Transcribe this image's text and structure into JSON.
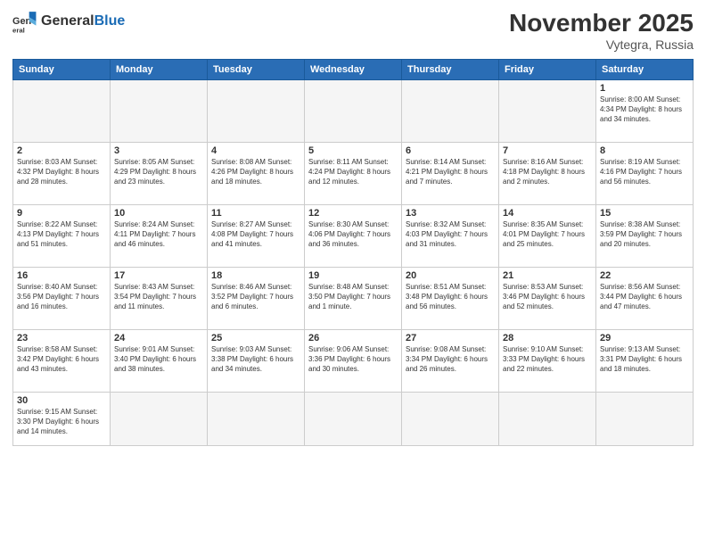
{
  "header": {
    "logo_general": "General",
    "logo_blue": "Blue",
    "title": "November 2025",
    "subtitle": "Vytegra, Russia"
  },
  "days_of_week": [
    "Sunday",
    "Monday",
    "Tuesday",
    "Wednesday",
    "Thursday",
    "Friday",
    "Saturday"
  ],
  "weeks": [
    [
      {
        "day": "",
        "info": "",
        "empty": true
      },
      {
        "day": "",
        "info": "",
        "empty": true
      },
      {
        "day": "",
        "info": "",
        "empty": true
      },
      {
        "day": "",
        "info": "",
        "empty": true
      },
      {
        "day": "",
        "info": "",
        "empty": true
      },
      {
        "day": "",
        "info": "",
        "empty": true
      },
      {
        "day": "1",
        "info": "Sunrise: 8:00 AM\nSunset: 4:34 PM\nDaylight: 8 hours\nand 34 minutes."
      }
    ],
    [
      {
        "day": "2",
        "info": "Sunrise: 8:03 AM\nSunset: 4:32 PM\nDaylight: 8 hours\nand 28 minutes."
      },
      {
        "day": "3",
        "info": "Sunrise: 8:05 AM\nSunset: 4:29 PM\nDaylight: 8 hours\nand 23 minutes."
      },
      {
        "day": "4",
        "info": "Sunrise: 8:08 AM\nSunset: 4:26 PM\nDaylight: 8 hours\nand 18 minutes."
      },
      {
        "day": "5",
        "info": "Sunrise: 8:11 AM\nSunset: 4:24 PM\nDaylight: 8 hours\nand 12 minutes."
      },
      {
        "day": "6",
        "info": "Sunrise: 8:14 AM\nSunset: 4:21 PM\nDaylight: 8 hours\nand 7 minutes."
      },
      {
        "day": "7",
        "info": "Sunrise: 8:16 AM\nSunset: 4:18 PM\nDaylight: 8 hours\nand 2 minutes."
      },
      {
        "day": "8",
        "info": "Sunrise: 8:19 AM\nSunset: 4:16 PM\nDaylight: 7 hours\nand 56 minutes."
      }
    ],
    [
      {
        "day": "9",
        "info": "Sunrise: 8:22 AM\nSunset: 4:13 PM\nDaylight: 7 hours\nand 51 minutes."
      },
      {
        "day": "10",
        "info": "Sunrise: 8:24 AM\nSunset: 4:11 PM\nDaylight: 7 hours\nand 46 minutes."
      },
      {
        "day": "11",
        "info": "Sunrise: 8:27 AM\nSunset: 4:08 PM\nDaylight: 7 hours\nand 41 minutes."
      },
      {
        "day": "12",
        "info": "Sunrise: 8:30 AM\nSunset: 4:06 PM\nDaylight: 7 hours\nand 36 minutes."
      },
      {
        "day": "13",
        "info": "Sunrise: 8:32 AM\nSunset: 4:03 PM\nDaylight: 7 hours\nand 31 minutes."
      },
      {
        "day": "14",
        "info": "Sunrise: 8:35 AM\nSunset: 4:01 PM\nDaylight: 7 hours\nand 25 minutes."
      },
      {
        "day": "15",
        "info": "Sunrise: 8:38 AM\nSunset: 3:59 PM\nDaylight: 7 hours\nand 20 minutes."
      }
    ],
    [
      {
        "day": "16",
        "info": "Sunrise: 8:40 AM\nSunset: 3:56 PM\nDaylight: 7 hours\nand 16 minutes."
      },
      {
        "day": "17",
        "info": "Sunrise: 8:43 AM\nSunset: 3:54 PM\nDaylight: 7 hours\nand 11 minutes."
      },
      {
        "day": "18",
        "info": "Sunrise: 8:46 AM\nSunset: 3:52 PM\nDaylight: 7 hours\nand 6 minutes."
      },
      {
        "day": "19",
        "info": "Sunrise: 8:48 AM\nSunset: 3:50 PM\nDaylight: 7 hours\nand 1 minute."
      },
      {
        "day": "20",
        "info": "Sunrise: 8:51 AM\nSunset: 3:48 PM\nDaylight: 6 hours\nand 56 minutes."
      },
      {
        "day": "21",
        "info": "Sunrise: 8:53 AM\nSunset: 3:46 PM\nDaylight: 6 hours\nand 52 minutes."
      },
      {
        "day": "22",
        "info": "Sunrise: 8:56 AM\nSunset: 3:44 PM\nDaylight: 6 hours\nand 47 minutes."
      }
    ],
    [
      {
        "day": "23",
        "info": "Sunrise: 8:58 AM\nSunset: 3:42 PM\nDaylight: 6 hours\nand 43 minutes."
      },
      {
        "day": "24",
        "info": "Sunrise: 9:01 AM\nSunset: 3:40 PM\nDaylight: 6 hours\nand 38 minutes."
      },
      {
        "day": "25",
        "info": "Sunrise: 9:03 AM\nSunset: 3:38 PM\nDaylight: 6 hours\nand 34 minutes."
      },
      {
        "day": "26",
        "info": "Sunrise: 9:06 AM\nSunset: 3:36 PM\nDaylight: 6 hours\nand 30 minutes."
      },
      {
        "day": "27",
        "info": "Sunrise: 9:08 AM\nSunset: 3:34 PM\nDaylight: 6 hours\nand 26 minutes."
      },
      {
        "day": "28",
        "info": "Sunrise: 9:10 AM\nSunset: 3:33 PM\nDaylight: 6 hours\nand 22 minutes."
      },
      {
        "day": "29",
        "info": "Sunrise: 9:13 AM\nSunset: 3:31 PM\nDaylight: 6 hours\nand 18 minutes."
      }
    ],
    [
      {
        "day": "30",
        "info": "Sunrise: 9:15 AM\nSunset: 3:30 PM\nDaylight: 6 hours\nand 14 minutes."
      },
      {
        "day": "",
        "info": "",
        "empty": true
      },
      {
        "day": "",
        "info": "",
        "empty": true
      },
      {
        "day": "",
        "info": "",
        "empty": true
      },
      {
        "day": "",
        "info": "",
        "empty": true
      },
      {
        "day": "",
        "info": "",
        "empty": true
      },
      {
        "day": "",
        "info": "",
        "empty": true
      }
    ]
  ]
}
